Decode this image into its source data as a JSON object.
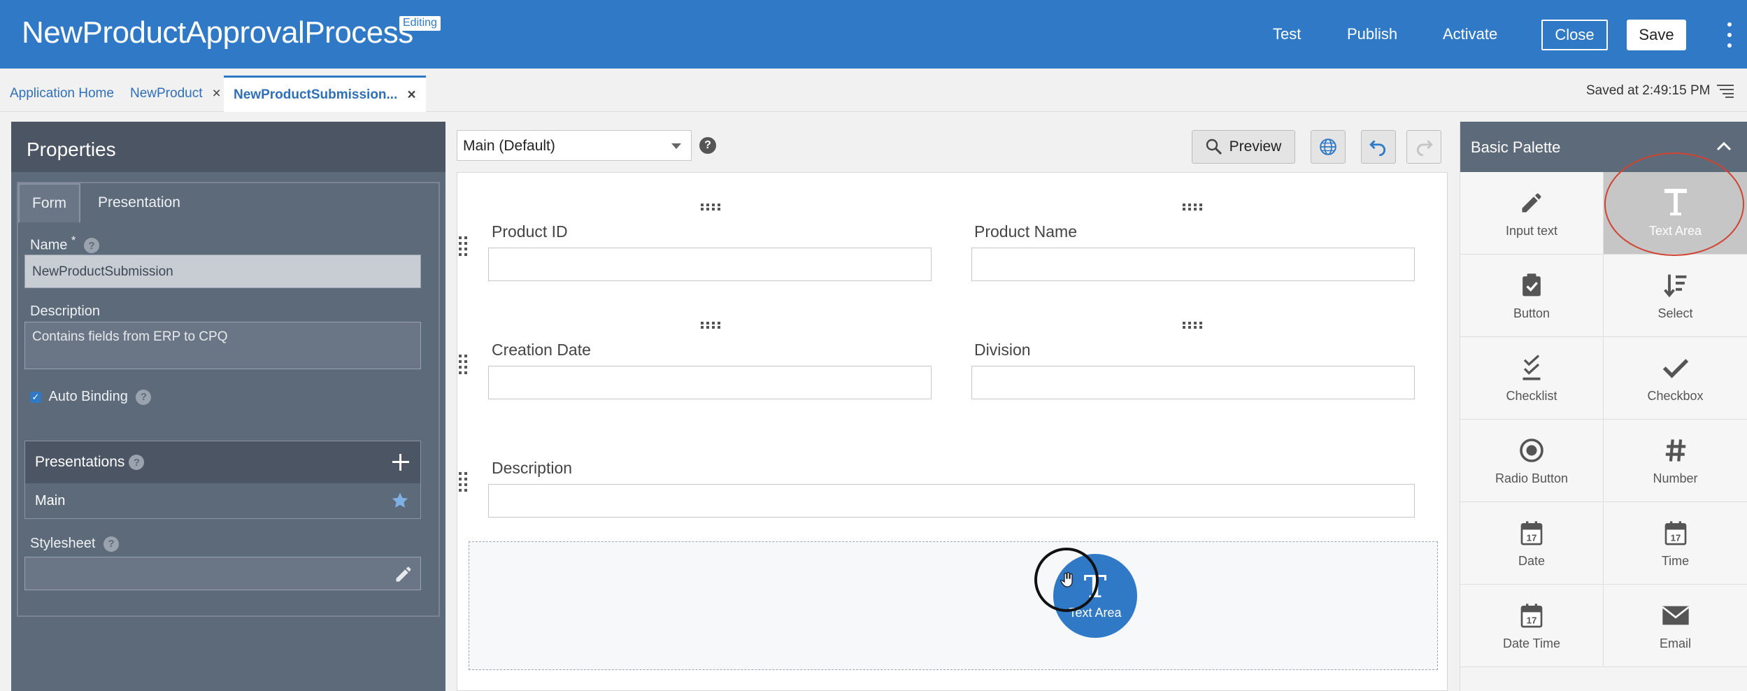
{
  "header": {
    "app_title": "NewProductApprovalProcess",
    "badge": "Editing",
    "links": [
      "Test",
      "Publish",
      "Activate"
    ],
    "close_label": "Close",
    "save_label": "Save"
  },
  "tabs": {
    "items": [
      {
        "label": "Application Home"
      },
      {
        "label": "NewProduct"
      },
      {
        "label": "NewProductSubmission..."
      }
    ],
    "close_glyph": "×",
    "saved_status": "Saved at 2:49:15 PM"
  },
  "properties": {
    "title": "Properties",
    "tab_form": "Form",
    "tab_presentation": "Presentation",
    "name_label": "Name",
    "name_required": "*",
    "name_value": "NewProductSubmission",
    "description_label": "Description",
    "description_value": "Contains fields from ERP to CPQ",
    "auto_binding_label": "Auto Binding",
    "auto_binding_checked": true,
    "presentations_label": "Presentations",
    "presentation_main": "Main",
    "stylesheet_label": "Stylesheet",
    "help_glyph": "?"
  },
  "toolbar": {
    "presentation_select": "Main (Default)",
    "preview_label": "Preview"
  },
  "form_canvas": {
    "fields": [
      {
        "label": "Product ID"
      },
      {
        "label": "Product Name"
      },
      {
        "label": "Creation Date"
      },
      {
        "label": "Division"
      },
      {
        "label": "Description"
      }
    ],
    "drag_item_label": "Text Area",
    "drag_item_glyph": "T"
  },
  "palette": {
    "title": "Basic Palette",
    "items": [
      {
        "label": "Input text",
        "icon": "pencil-icon"
      },
      {
        "label": "Text Area",
        "icon": "text-area-icon",
        "selected": true
      },
      {
        "label": "Button",
        "icon": "button-icon"
      },
      {
        "label": "Select",
        "icon": "select-icon"
      },
      {
        "label": "Checklist",
        "icon": "checklist-icon"
      },
      {
        "label": "Checkbox",
        "icon": "checkmark-icon"
      },
      {
        "label": "Radio Button",
        "icon": "radio-icon"
      },
      {
        "label": "Number",
        "icon": "hash-icon"
      },
      {
        "label": "Date",
        "icon": "calendar-icon"
      },
      {
        "label": "Time",
        "icon": "calendar-icon"
      },
      {
        "label": "Date Time",
        "icon": "calendar-icon"
      },
      {
        "label": "Email",
        "icon": "envelope-icon"
      }
    ],
    "calendar_day": "17"
  },
  "colors": {
    "brand_blue": "#2f79c6",
    "panel_dark": "#4b5563",
    "annotation_red": "#d04434"
  }
}
